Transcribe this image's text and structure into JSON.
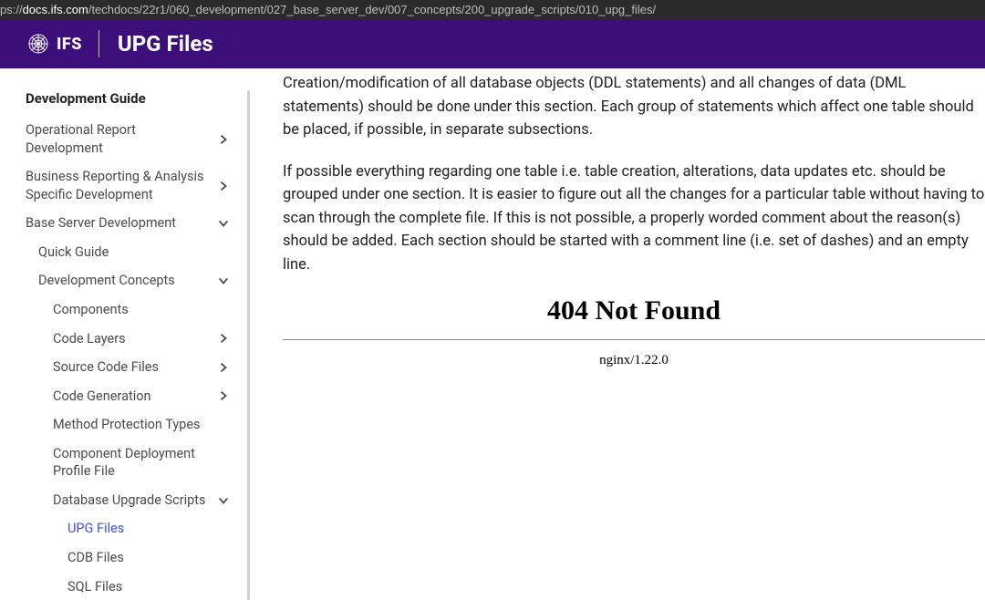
{
  "url": {
    "prefix": "ps://",
    "host": "docs.ifs.com",
    "path": "/techdocs/22r1/060_development/027_base_server_dev/007_concepts/200_upgrade_scripts/010_upg_files/"
  },
  "header": {
    "brand": "IFS",
    "title": "UPG Files"
  },
  "sidebar": {
    "guide": "Development Guide",
    "items": [
      {
        "label": "Operational Report Development",
        "indent": 0,
        "chev": "right"
      },
      {
        "label": "Business Reporting & Analysis Specific Development",
        "indent": 0,
        "chev": "right"
      },
      {
        "label": "Base Server Development",
        "indent": 0,
        "chev": "down"
      },
      {
        "label": "Quick Guide",
        "indent": 1,
        "chev": ""
      },
      {
        "label": "Development Concepts",
        "indent": 1,
        "chev": "down"
      },
      {
        "label": "Components",
        "indent": 2,
        "chev": ""
      },
      {
        "label": "Code Layers",
        "indent": 2,
        "chev": "right"
      },
      {
        "label": "Source Code Files",
        "indent": 2,
        "chev": "right"
      },
      {
        "label": "Code Generation",
        "indent": 2,
        "chev": "right"
      },
      {
        "label": "Method Protection Types",
        "indent": 2,
        "chev": ""
      },
      {
        "label": "Component Deployment Profile File",
        "indent": 2,
        "chev": ""
      },
      {
        "label": "Database Upgrade Scripts",
        "indent": 2,
        "chev": "down"
      },
      {
        "label": "UPG Files",
        "indent": 3,
        "chev": "",
        "active": true
      },
      {
        "label": "CDB Files",
        "indent": 3,
        "chev": ""
      },
      {
        "label": "SQL Files",
        "indent": 3,
        "chev": ""
      }
    ]
  },
  "content": {
    "p1": "Creation/modification of all database objects (DDL statements) and all changes of data (DML statements) should be done under this section. Each group of statements which affect one table should be placed, if possible, in separate subsections.",
    "p2": "If possible everything regarding one table i.e. table creation, alterations, data updates etc. should be grouped under one section. It is easier to figure out all the changes for a particular table without having to scan through the complete file. If this is not possible, a properly worded comment about the reason(s) should be added. Each section should be started with a comment line (i.e. set of dashes) and an empty line.",
    "error_title": "404 Not Found",
    "error_server": "nginx/1.22.0"
  }
}
